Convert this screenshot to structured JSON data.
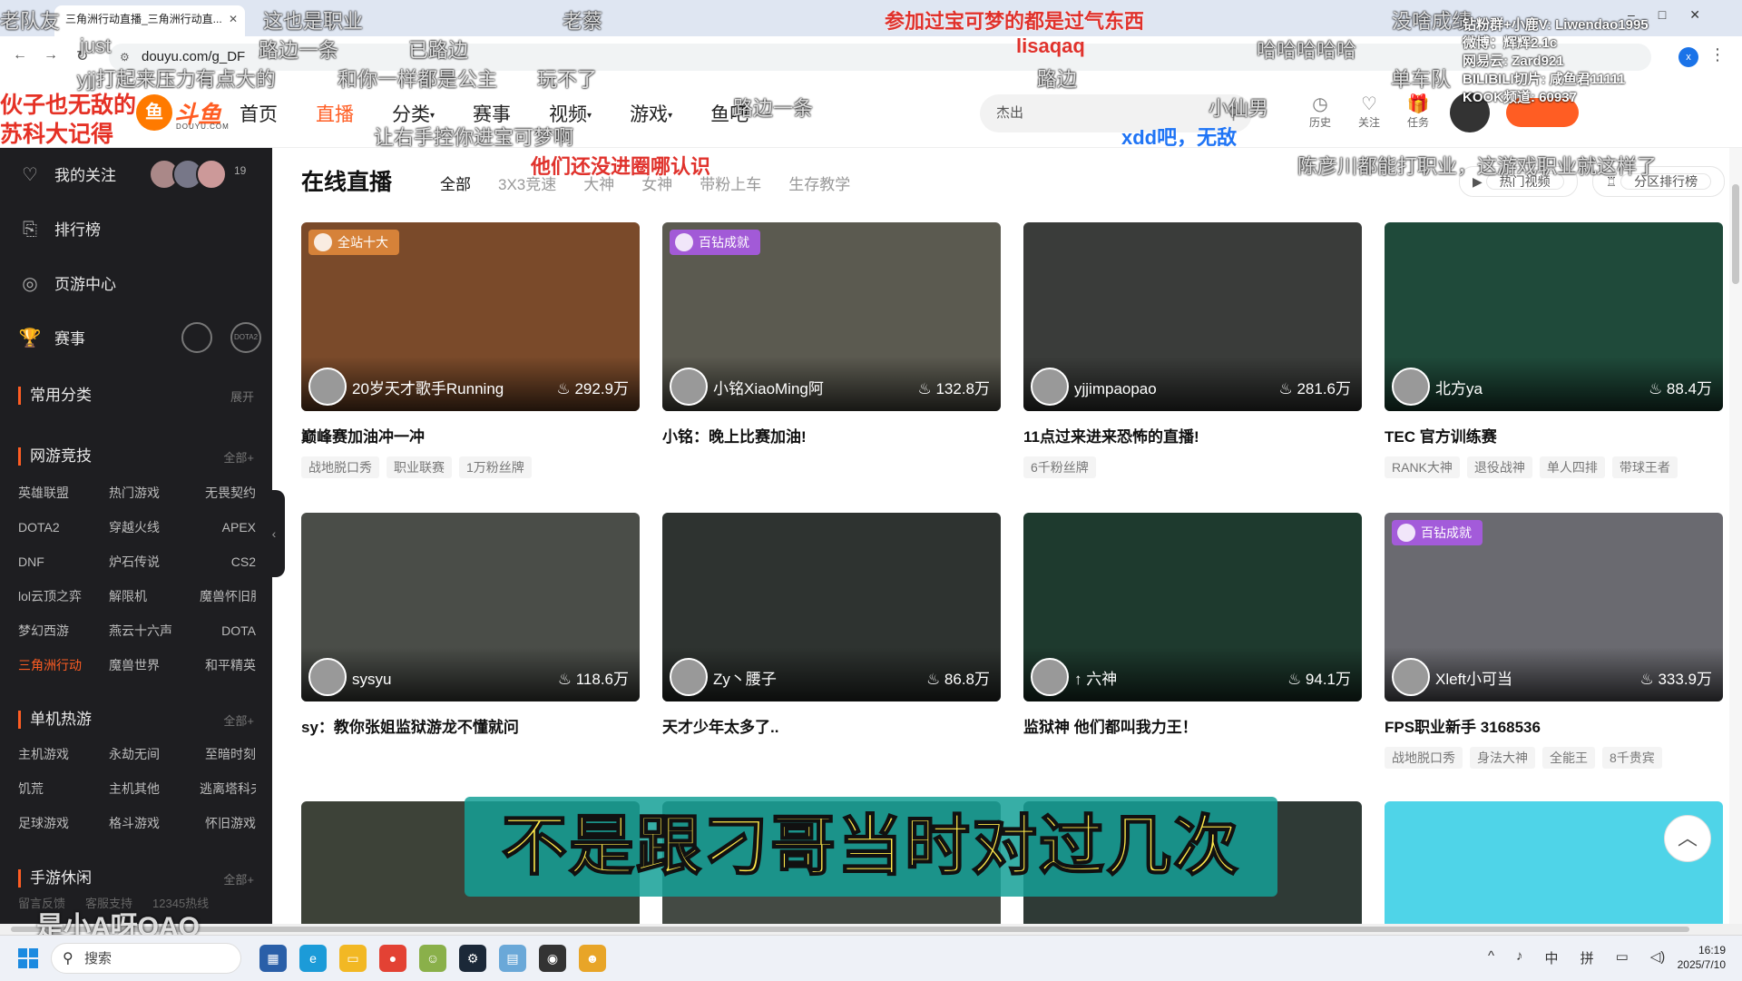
{
  "browser": {
    "tab_title": "三角洲行动直播_三角洲行动直...",
    "url": "douyu.com/g_DF"
  },
  "site": {
    "logo_text": "斗鱼",
    "logo_sub": "DOUYU.COM",
    "nav": [
      "首页",
      "直播",
      "分类",
      "赛事",
      "视频",
      "游戏",
      "鱼吧"
    ],
    "search_placeholder": "杰出",
    "header_icons": [
      "历史",
      "关注",
      "任务"
    ]
  },
  "sidebar": {
    "favorites_label": "我的关注",
    "favorites_count": "19",
    "ranking_label": "排行榜",
    "pagegame_label": "页游中心",
    "match_label": "赛事",
    "match_logos": [
      "",
      "DOTA2"
    ],
    "common_section": "常用分类",
    "common_more": "展开",
    "online_section": "网游竞技",
    "online_more": "全部+",
    "online_games": [
      "英雄联盟",
      "热门游戏",
      "无畏契约",
      "DOTA2",
      "穿越火线",
      "APEX",
      "DNF",
      "炉石传说",
      "CS2",
      "lol云顶之弈",
      "解限机",
      "魔兽怀旧服",
      "梦幻西游",
      "燕云十六声",
      "DOTA",
      "三角洲行动",
      "魔兽世界",
      "和平精英"
    ],
    "single_section": "单机热游",
    "single_more": "全部+",
    "single_games": [
      "主机游戏",
      "永劫无间",
      "至暗时刻",
      "饥荒",
      "主机其他",
      "逃离塔科夫",
      "足球游戏",
      "格斗游戏",
      "怀旧游戏"
    ],
    "mobile_section": "手游休闲",
    "mobile_more": "全部+",
    "footer_links": [
      "留言反馈",
      "客服支持",
      "12345热线"
    ]
  },
  "content": {
    "page_title": "在线直播",
    "filters": [
      "全部",
      "3X3竞速",
      "大神",
      "女神",
      "带粉上车",
      "生存教学"
    ],
    "right_links": [
      "热门视频",
      "分区排行榜"
    ],
    "cards": [
      {
        "badge": "全站十大",
        "badge_type": "gold",
        "anchor": "20岁天才歌手Running",
        "hot": "292.9万",
        "title": "巅峰赛加油冲一冲",
        "tags": [
          "战地脱口秀",
          "职业联赛",
          "1万粉丝牌"
        ],
        "bg": "#7a4a2a"
      },
      {
        "badge": "百钻成就",
        "badge_type": "purple",
        "anchor": "小铭XiaoMing阿",
        "hot": "132.8万",
        "title": "小铭：晚上比赛加油!",
        "tags": [],
        "bg": "#5b5a50"
      },
      {
        "badge": "",
        "badge_type": "",
        "anchor": "yjjimpaopao",
        "hot": "281.6万",
        "title": "11点过来进来恐怖的直播!",
        "tags": [
          "6千粉丝牌"
        ],
        "bg": "#3a3c3a"
      },
      {
        "badge": "",
        "badge_type": "",
        "anchor": "北方ya",
        "hot": "88.4万",
        "title": "TEC 官方训练赛",
        "tags": [
          "RANK大神",
          "退役战神",
          "单人四排",
          "带球王者"
        ],
        "bg": "#1f4a3a"
      },
      {
        "badge": "",
        "badge_type": "",
        "anchor": "sysyu",
        "hot": "118.6万",
        "title": "sy：教你张姐监狱游龙不懂就问",
        "tags": [],
        "bg": "#4a4d48"
      },
      {
        "badge": "",
        "badge_type": "",
        "anchor": "Zy丶腰子",
        "hot": "86.8万",
        "title": "天才少年太多了..",
        "tags": [],
        "bg": "#2e3330"
      },
      {
        "badge": "",
        "badge_type": "",
        "anchor": "↑ 六神",
        "hot": "94.1万",
        "title": "监狱神 他们都叫我力王！",
        "tags": [],
        "bg": "#1e3a2e"
      },
      {
        "badge": "百钻成就",
        "badge_type": "purple",
        "anchor": "Xleft小可当",
        "hot": "333.9万",
        "title": "FPS职业新手 3168536",
        "tags": [
          "战地脱口秀",
          "身法大神",
          "全能王",
          "8千贵宾"
        ],
        "bg": "#6a6a70"
      }
    ],
    "row3_bgs": [
      "#3d4238",
      "#444a44",
      "#2f3a36",
      "#4fd4e8"
    ]
  },
  "overlay": {
    "subtitle": "不是跟刁哥当时对过几次",
    "watermark": "是小A呀QAQ",
    "left_red": [
      "伙子也无敌的",
      "苏科大记得"
    ],
    "streamer_info": [
      "钻粉群+小鹿V: Liwendao1995",
      "微博：辉辉2.1c",
      "网易云: Zard921",
      "BILIBILI切片: 咸鱼君11111",
      "KOOK频道: 60937"
    ],
    "danmaku": [
      {
        "text": "老队友",
        "style": "white"
      },
      {
        "text": "这也是职业",
        "style": "white"
      },
      {
        "text": "老蔡",
        "style": "white"
      },
      {
        "text": "参加过宝可梦的都是过气东西",
        "style": "red"
      },
      {
        "text": "没啥成绩",
        "style": "white"
      },
      {
        "text": "just",
        "style": "white"
      },
      {
        "text": "路边一条",
        "style": "white"
      },
      {
        "text": "已路边",
        "style": "white"
      },
      {
        "text": "lisaqaq",
        "style": "red"
      },
      {
        "text": "哈哈哈哈哈",
        "style": "white"
      },
      {
        "text": "yjj打起来压力有点大的",
        "style": "white"
      },
      {
        "text": "和你一样都是公主",
        "style": "white"
      },
      {
        "text": "玩不了",
        "style": "white"
      },
      {
        "text": "路边",
        "style": "white"
      },
      {
        "text": "单车队",
        "style": "white"
      },
      {
        "text": "路边一条",
        "style": "white"
      },
      {
        "text": "小仙男",
        "style": "white"
      },
      {
        "text": "让右手控你进宝可梦啊",
        "style": "white"
      },
      {
        "text": "xdd吧，无敌",
        "style": "blue"
      },
      {
        "text": "他们还没进圈哪认识",
        "style": "red"
      },
      {
        "text": "陈彦川都能打职业，这游戏职业就这样了",
        "style": "white"
      }
    ]
  },
  "taskbar": {
    "search_label": "搜索",
    "tray": [
      "^",
      "中",
      "拼"
    ],
    "time": "16:19",
    "date": "2025/7/10"
  }
}
